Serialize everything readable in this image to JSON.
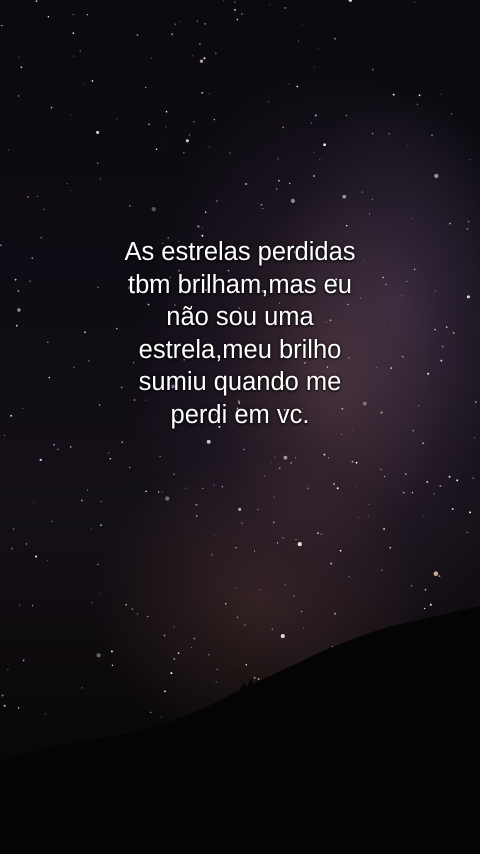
{
  "quote": {
    "lines": [
      "As estrelas perdidas",
      "tbm brilham,mas eu",
      "não sou uma",
      "estrela,meu brilho",
      "sumiu quando me",
      "perdi em vc."
    ],
    "color": "#ffffff"
  },
  "background": {
    "description_icon": "night-sky-milky-way",
    "sky_color": "#0b0a10",
    "glow_color": "#7a5060",
    "horizon_color": "#050505"
  }
}
